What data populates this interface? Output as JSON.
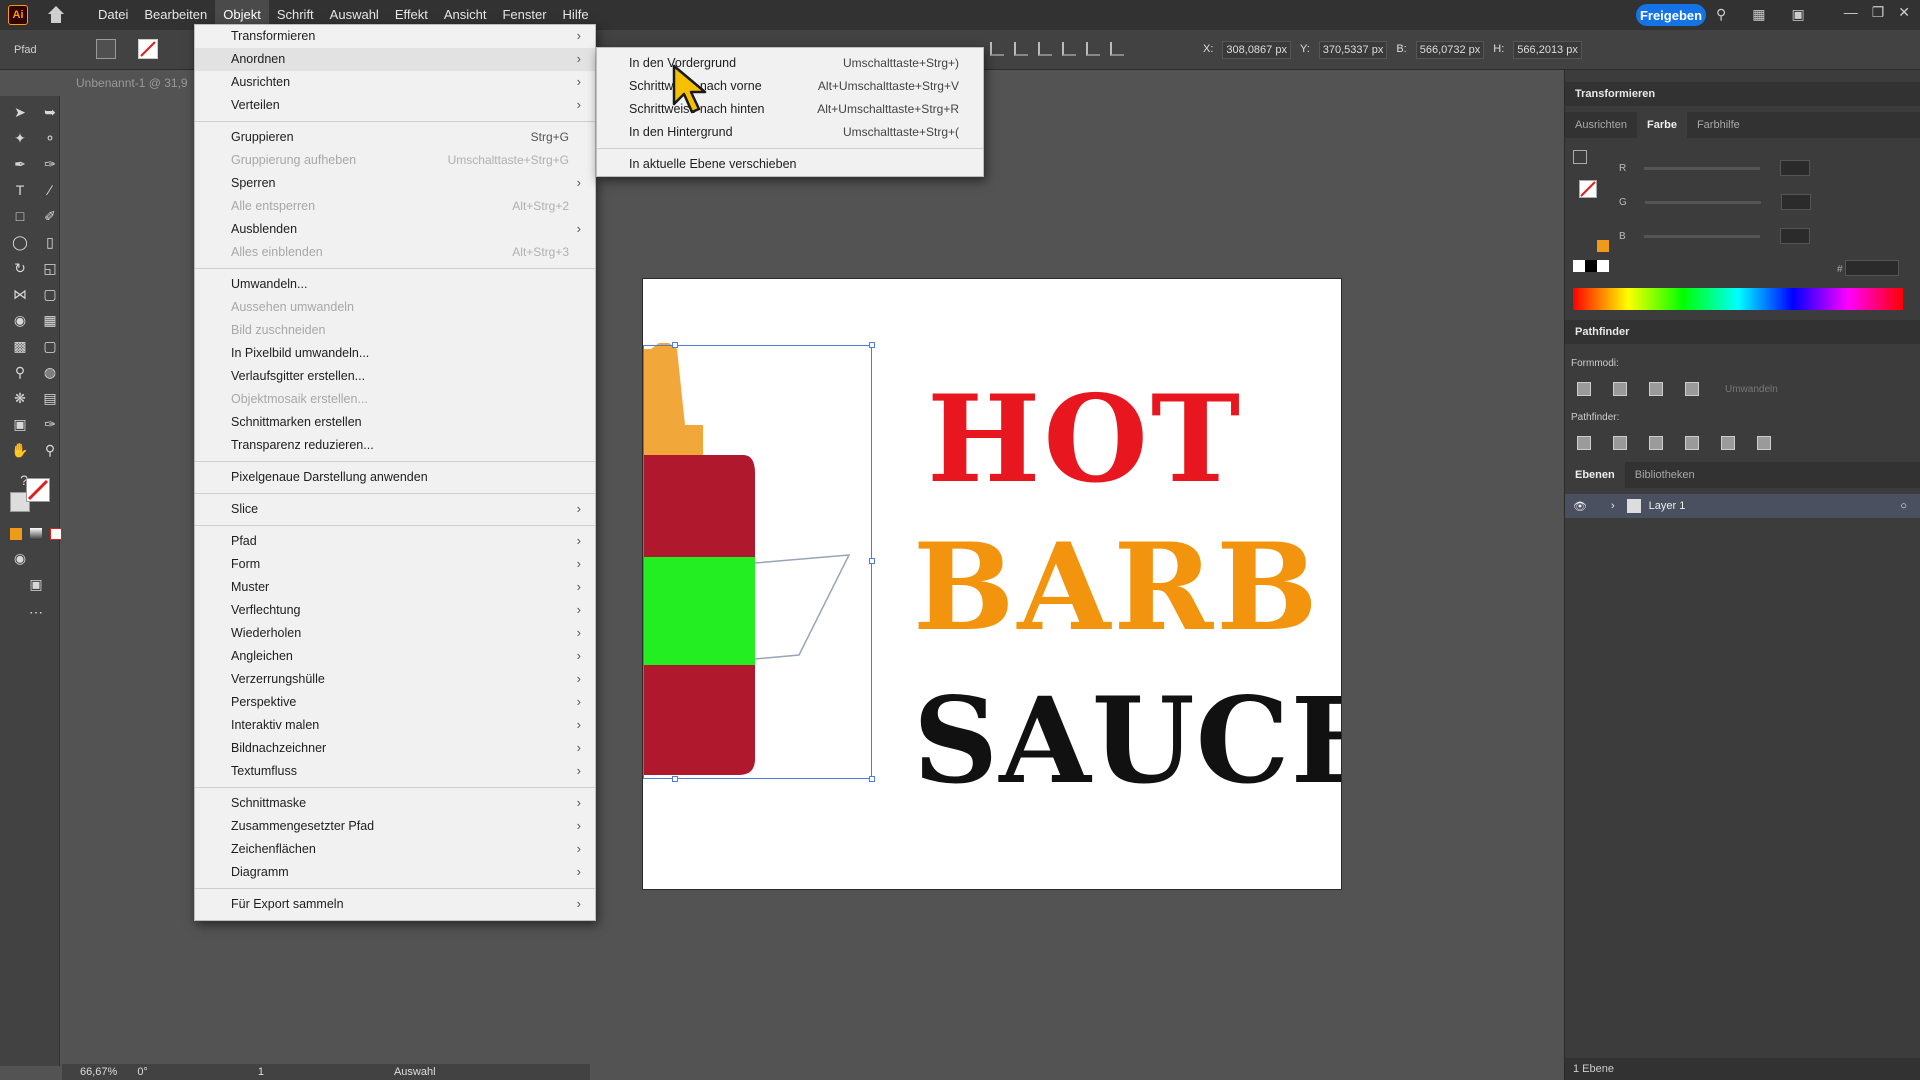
{
  "app": {
    "logo": "Ai"
  },
  "menubar": {
    "items": [
      "Datei",
      "Bearbeiten",
      "Objekt",
      "Schrift",
      "Auswahl",
      "Effekt",
      "Ansicht",
      "Fenster",
      "Hilfe"
    ],
    "active_index": 2,
    "share_label": "Freigeben"
  },
  "controlbar": {
    "label": "Pfad",
    "x_label": "X:",
    "x_value": "308,0867 px",
    "y_label": "Y:",
    "y_value": "370,5337 px",
    "w_label": "B:",
    "w_value": "566,0732 px",
    "h_label": "H:",
    "h_value": "566,2013 px"
  },
  "document": {
    "tab_title": "Unbenannt-1 @ 31,9"
  },
  "artwork": {
    "line1": "HOT",
    "line1_color": "#e8171f",
    "line2": "BARB",
    "line2_color": "#f3940f",
    "line3": "SAUCE",
    "line3_color": "#111111",
    "bottle_color": "#b0182e",
    "cap_color": "#f1a73a",
    "label_color": "#22ee22"
  },
  "statusbar": {
    "zoom": "66,67%",
    "rotation": "0°",
    "artboard": "1",
    "mode": "Auswahl"
  },
  "panels": {
    "transform_title": "Transformieren",
    "color_tabs": [
      "Ausrichten",
      "Farbe",
      "Farbhilfe"
    ],
    "rgb": [
      "R",
      "G",
      "B"
    ],
    "hex_label": "#",
    "pathfinder_title": "Pathfinder",
    "formmodi_label": "Formmodi:",
    "umwandeln_label": "Umwandeln",
    "pathfinder_label": "Pathfinder:",
    "layer_tabs": [
      "Ebenen",
      "Bibliotheken"
    ],
    "layer_name": "Layer 1",
    "footer": "1 Ebene"
  },
  "menu": {
    "items": [
      {
        "label": "Transformieren",
        "shortcut": "",
        "submenu": true,
        "disabled": false
      },
      {
        "label": "Anordnen",
        "shortcut": "",
        "submenu": true,
        "disabled": false,
        "highlight": true
      },
      {
        "label": "Ausrichten",
        "shortcut": "",
        "submenu": true,
        "disabled": false
      },
      {
        "label": "Verteilen",
        "shortcut": "",
        "submenu": true,
        "disabled": false
      },
      {
        "label": "Gruppieren",
        "shortcut": "Strg+G",
        "submenu": false,
        "disabled": false
      },
      {
        "label": "Gruppierung aufheben",
        "shortcut": "Umschalttaste+Strg+G",
        "submenu": false,
        "disabled": true
      },
      {
        "label": "Sperren",
        "shortcut": "",
        "submenu": true,
        "disabled": false
      },
      {
        "label": "Alle entsperren",
        "shortcut": "Alt+Strg+2",
        "submenu": false,
        "disabled": true
      },
      {
        "label": "Ausblenden",
        "shortcut": "",
        "submenu": true,
        "disabled": false
      },
      {
        "label": "Alles einblenden",
        "shortcut": "Alt+Strg+3",
        "submenu": false,
        "disabled": true
      },
      {
        "label": "Umwandeln...",
        "shortcut": "",
        "submenu": false,
        "disabled": false
      },
      {
        "label": "Aussehen umwandeln",
        "shortcut": "",
        "submenu": false,
        "disabled": true
      },
      {
        "label": "Bild zuschneiden",
        "shortcut": "",
        "submenu": false,
        "disabled": true
      },
      {
        "label": "In Pixelbild umwandeln...",
        "shortcut": "",
        "submenu": false,
        "disabled": false
      },
      {
        "label": "Verlaufsgitter erstellen...",
        "shortcut": "",
        "submenu": false,
        "disabled": false
      },
      {
        "label": "Objektmosaik erstellen...",
        "shortcut": "",
        "submenu": false,
        "disabled": true
      },
      {
        "label": "Schnittmarken erstellen",
        "shortcut": "",
        "submenu": false,
        "disabled": false
      },
      {
        "label": "Transparenz reduzieren...",
        "shortcut": "",
        "submenu": false,
        "disabled": false
      },
      {
        "label": "Pixelgenaue Darstellung anwenden",
        "shortcut": "",
        "submenu": false,
        "disabled": false
      },
      {
        "label": "Slice",
        "shortcut": "",
        "submenu": true,
        "disabled": false
      },
      {
        "label": "Pfad",
        "shortcut": "",
        "submenu": true,
        "disabled": false
      },
      {
        "label": "Form",
        "shortcut": "",
        "submenu": true,
        "disabled": false
      },
      {
        "label": "Muster",
        "shortcut": "",
        "submenu": true,
        "disabled": false
      },
      {
        "label": "Verflechtung",
        "shortcut": "",
        "submenu": true,
        "disabled": false
      },
      {
        "label": "Wiederholen",
        "shortcut": "",
        "submenu": true,
        "disabled": false
      },
      {
        "label": "Angleichen",
        "shortcut": "",
        "submenu": true,
        "disabled": false
      },
      {
        "label": "Verzerrungshülle",
        "shortcut": "",
        "submenu": true,
        "disabled": false
      },
      {
        "label": "Perspektive",
        "shortcut": "",
        "submenu": true,
        "disabled": false
      },
      {
        "label": "Interaktiv malen",
        "shortcut": "",
        "submenu": true,
        "disabled": false
      },
      {
        "label": "Bildnachzeichner",
        "shortcut": "",
        "submenu": true,
        "disabled": false
      },
      {
        "label": "Textumfluss",
        "shortcut": "",
        "submenu": true,
        "disabled": false
      },
      {
        "label": "Schnittmaske",
        "shortcut": "",
        "submenu": true,
        "disabled": false
      },
      {
        "label": "Zusammengesetzter Pfad",
        "shortcut": "",
        "submenu": true,
        "disabled": false
      },
      {
        "label": "Zeichenflächen",
        "shortcut": "",
        "submenu": true,
        "disabled": false
      },
      {
        "label": "Diagramm",
        "shortcut": "",
        "submenu": true,
        "disabled": false
      },
      {
        "label": "Für Export sammeln",
        "shortcut": "",
        "submenu": true,
        "disabled": false
      }
    ]
  },
  "submenu": {
    "items": [
      {
        "label": "In den Vordergrund",
        "shortcut": "Umschalttaste+Strg+)"
      },
      {
        "label": "Schrittweise nach vorne",
        "shortcut": "Alt+Umschalttaste+Strg+V"
      },
      {
        "label": "Schrittweise nach hinten",
        "shortcut": "Alt+Umschalttaste+Strg+R"
      },
      {
        "label": "In den Hintergrund",
        "shortcut": "Umschalttaste+Strg+("
      },
      {
        "label": "In aktuelle Ebene verschieben",
        "shortcut": ""
      }
    ]
  }
}
